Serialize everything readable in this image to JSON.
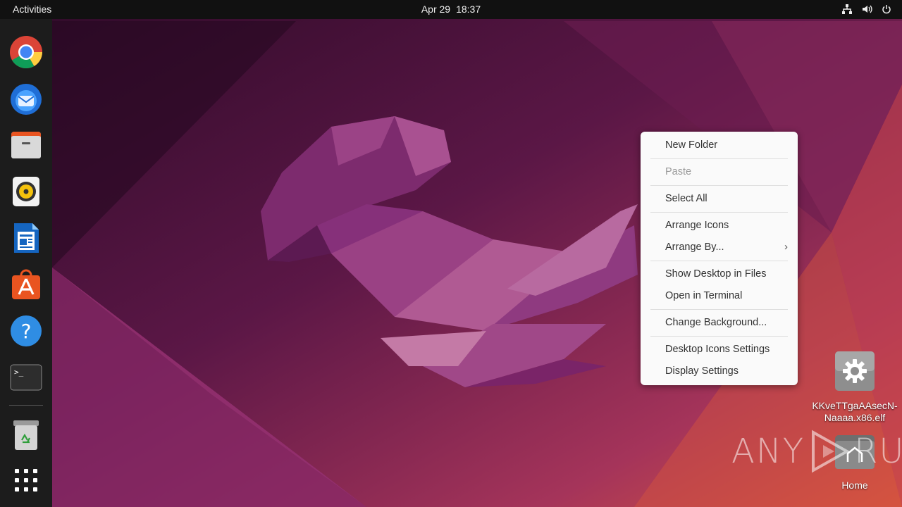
{
  "topbar": {
    "activities": "Activities",
    "date": "Apr 29",
    "time": "18:37",
    "tray": [
      "network-icon",
      "volume-icon",
      "power-icon"
    ]
  },
  "dock": {
    "items": [
      {
        "name": "Google Chrome",
        "icon": "chrome-icon"
      },
      {
        "name": "Thunderbird Mail",
        "icon": "thunderbird-icon"
      },
      {
        "name": "Files",
        "icon": "files-icon"
      },
      {
        "name": "Rhythmbox",
        "icon": "rhythmbox-icon"
      },
      {
        "name": "LibreOffice Writer",
        "icon": "writer-icon"
      },
      {
        "name": "Ubuntu Software",
        "icon": "software-icon"
      },
      {
        "name": "Help",
        "icon": "help-icon"
      },
      {
        "name": "Terminal",
        "icon": "terminal-icon"
      },
      {
        "name": "Trash",
        "icon": "trash-icon"
      },
      {
        "name": "Show Applications",
        "icon": "app-grid-icon"
      }
    ],
    "terminal_glyph": ">_"
  },
  "desktop": {
    "file_icon_label": "KKveTTgaAAsecN-Naaaa.x86.elf",
    "home_icon_label": "Home"
  },
  "context_menu": {
    "items": {
      "new_folder": "New Folder",
      "paste": "Paste",
      "select_all": "Select All",
      "arrange_icons": "Arrange Icons",
      "arrange_by": "Arrange By...",
      "show_desktop_in_files": "Show Desktop in Files",
      "open_in_terminal": "Open in Terminal",
      "change_background": "Change Background...",
      "desktop_icons_settings": "Desktop Icons Settings",
      "display_settings": "Display Settings"
    },
    "submenu_glyph": "›"
  },
  "watermark": {
    "left": "ANY",
    "right": "RUN"
  },
  "colors": {
    "topbar": "#111111",
    "dock": "#1c1c1c",
    "menu_bg": "#fafafa",
    "ubuntu_orange": "#e95420"
  }
}
